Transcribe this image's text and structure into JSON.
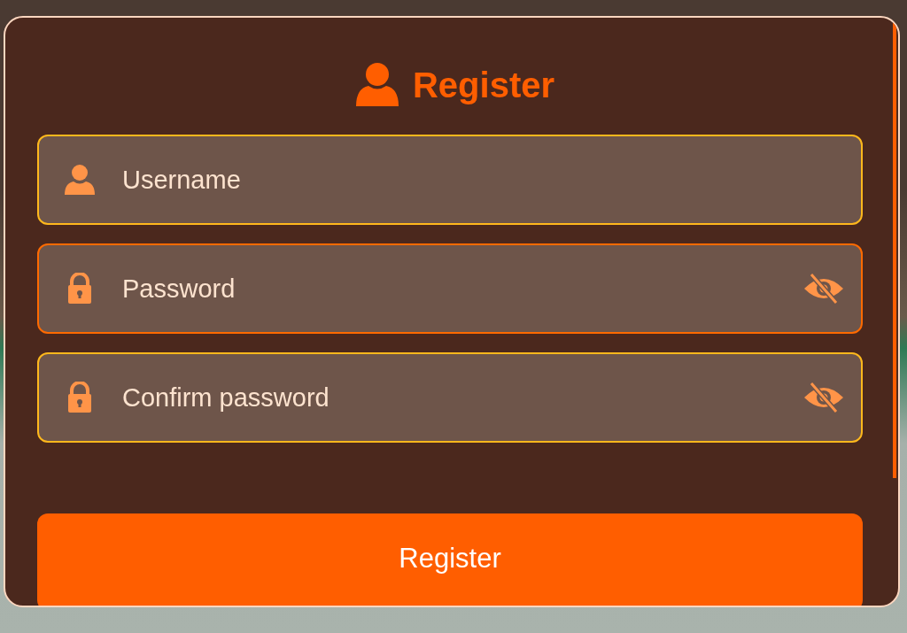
{
  "dialog": {
    "title": "Register",
    "fields": [
      {
        "kind": "text",
        "placeholder": "Username",
        "focused": false
      },
      {
        "kind": "password",
        "placeholder": "Password",
        "focused": true,
        "visible": false
      },
      {
        "kind": "password",
        "placeholder": "Confirm password",
        "focused": false,
        "visible": false
      }
    ],
    "submit": {
      "label": "Register"
    }
  }
}
